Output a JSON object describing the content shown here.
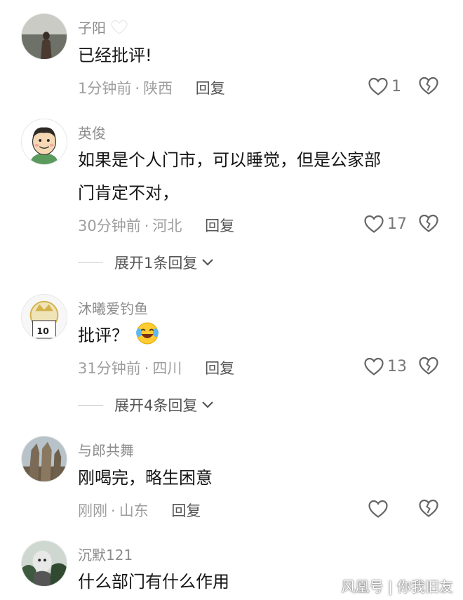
{
  "comments": [
    {
      "username": "子阳",
      "username_badge": "white-heart",
      "content": [
        "已经批评!"
      ],
      "time": "1分钟前",
      "location": "陕西",
      "reply": "回复",
      "likes": "1"
    },
    {
      "username": "英俊",
      "content": [
        "如果是个人门市，可以睡觉，但是公家部",
        "门肯定不对，"
      ],
      "time": "30分钟前",
      "location": "河北",
      "reply": "回复",
      "likes": "17",
      "expand": "展开1条回复"
    },
    {
      "username": "沐曦爱钓鱼",
      "content": [
        "批评？"
      ],
      "content_emoji": "laughing-crying-emoji",
      "time": "31分钟前",
      "location": "四川",
      "reply": "回复",
      "likes": "13",
      "expand": "展开4条回复"
    },
    {
      "username": "与郎共舞",
      "content": [
        "刚喝完，略生困意"
      ],
      "time": "刚刚",
      "location": "山东",
      "reply": "回复",
      "likes": ""
    },
    {
      "username": "沉默121",
      "content": [
        "什么部门有什么作用"
      ]
    }
  ],
  "meta_separator": "·",
  "watermark": "风凰号 | 你我旧友",
  "colors": {
    "username": "#8c8c8c",
    "content": "#161616",
    "meta": "#9e9e9e"
  }
}
